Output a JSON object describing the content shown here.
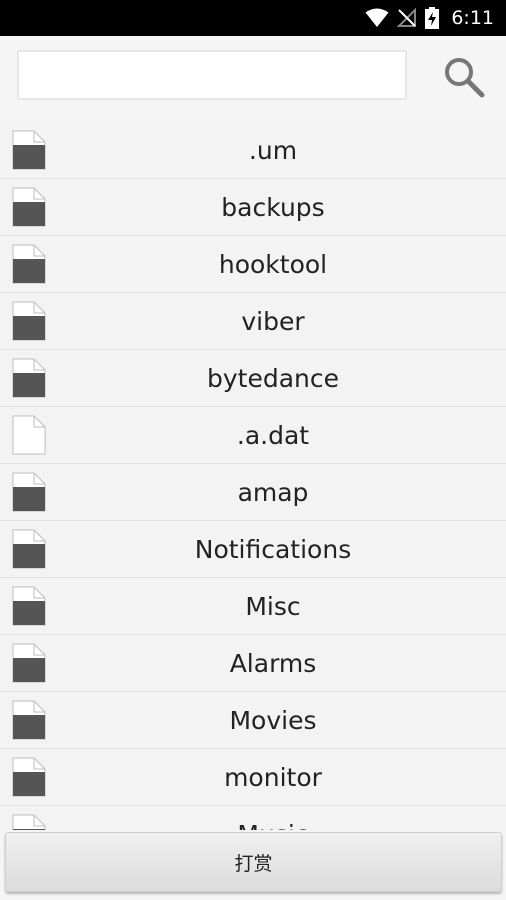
{
  "status_bar": {
    "time": "6:11",
    "icons": [
      "wifi-icon",
      "no-signal-icon",
      "battery-charging-icon"
    ]
  },
  "search": {
    "value": "",
    "placeholder": "",
    "button_icon": "search-icon"
  },
  "files": [
    {
      "name": ".um",
      "type": "folder"
    },
    {
      "name": "backups",
      "type": "folder"
    },
    {
      "name": "hooktool",
      "type": "folder"
    },
    {
      "name": "viber",
      "type": "folder"
    },
    {
      "name": "bytedance",
      "type": "folder"
    },
    {
      "name": ".a.dat",
      "type": "file"
    },
    {
      "name": "amap",
      "type": "folder"
    },
    {
      "name": "Notifications",
      "type": "folder"
    },
    {
      "name": "Misc",
      "type": "folder"
    },
    {
      "name": "Alarms",
      "type": "folder"
    },
    {
      "name": "Movies",
      "type": "folder"
    },
    {
      "name": "monitor",
      "type": "folder"
    },
    {
      "name": "Music",
      "type": "folder"
    }
  ],
  "bottom": {
    "donate_label": "打赏"
  }
}
